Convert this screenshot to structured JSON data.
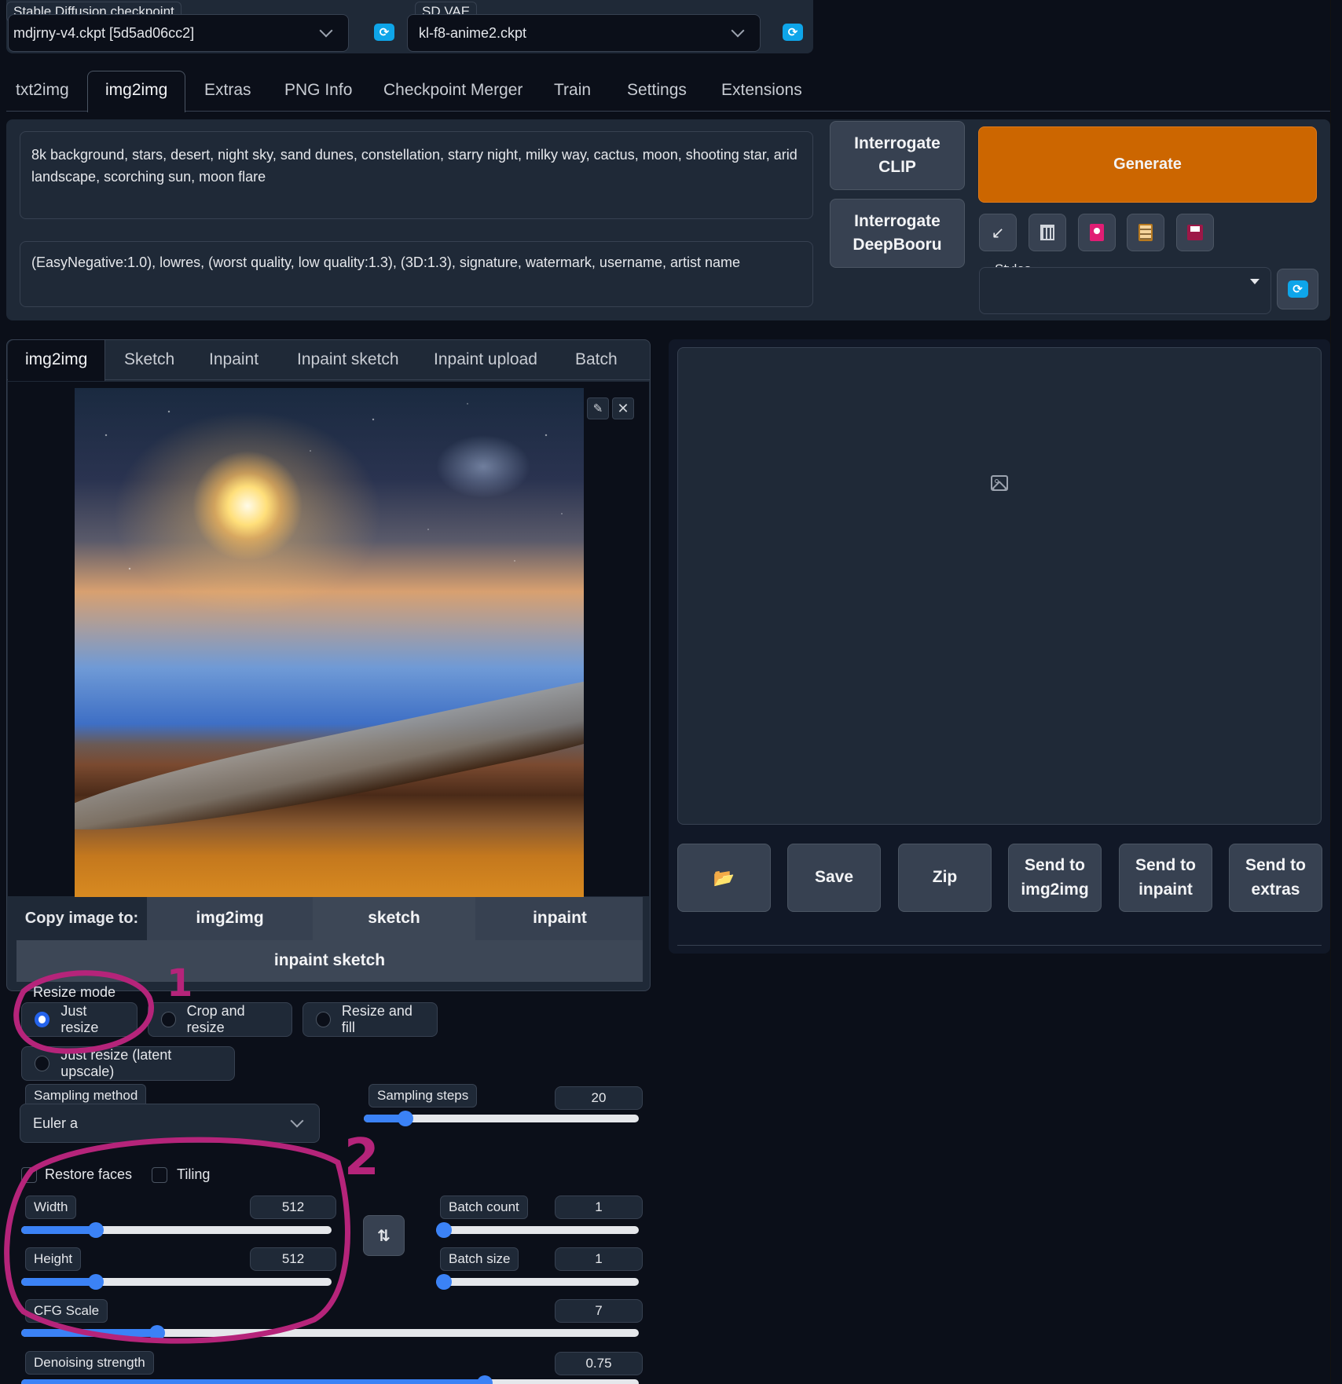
{
  "checkpoint": {
    "label": "Stable Diffusion checkpoint",
    "value": "mdjrny-v4.ckpt [5d5ad06cc2]"
  },
  "vae": {
    "label": "SD VAE",
    "value": "kl-f8-anime2.ckpt"
  },
  "main_tabs": [
    "txt2img",
    "img2img",
    "Extras",
    "PNG Info",
    "Checkpoint Merger",
    "Train",
    "Settings",
    "Extensions"
  ],
  "prompt": "8k background, stars, desert, night sky, sand dunes, constellation, starry night, milky way, cactus, moon, shooting star, arid landscape, scorching sun, moon flare",
  "negative_prompt": "(EasyNegative:1.0), lowres, (worst quality, low quality:1.3), (3D:1.3), signature, watermark, username, artist name",
  "buttons": {
    "interrogate_clip": "Interrogate CLIP",
    "interrogate_deepbooru": "Interrogate DeepBooru",
    "generate": "Generate",
    "tool_icons": [
      "↙",
      "🗑",
      "◼",
      "📋",
      "💾"
    ]
  },
  "styles_label": "Styles",
  "sub_tabs": [
    "img2img",
    "Sketch",
    "Inpaint",
    "Inpaint sketch",
    "Inpaint upload",
    "Batch"
  ],
  "copy_image": {
    "label": "Copy image to:",
    "targets": [
      "img2img",
      "sketch",
      "inpaint",
      "inpaint sketch"
    ]
  },
  "resize_mode": {
    "label": "Resize mode",
    "options": [
      "Just resize",
      "Crop and resize",
      "Resize and fill",
      "Just resize (latent upscale)"
    ],
    "selected": "Just resize"
  },
  "sampling_method": {
    "label": "Sampling method",
    "value": "Euler a"
  },
  "sampling_steps": {
    "label": "Sampling steps",
    "value": "20",
    "fraction": 0.15
  },
  "checkboxes": {
    "restore_faces": "Restore faces",
    "tiling": "Tiling"
  },
  "width": {
    "label": "Width",
    "value": "512",
    "fraction": 0.24
  },
  "height": {
    "label": "Height",
    "value": "512",
    "fraction": 0.24
  },
  "batch_count": {
    "label": "Batch count",
    "value": "1",
    "fraction": 0.0
  },
  "batch_size": {
    "label": "Batch size",
    "value": "1",
    "fraction": 0.0
  },
  "cfg_scale": {
    "label": "CFG Scale",
    "value": "7",
    "fraction": 0.22
  },
  "denoising": {
    "label": "Denoising strength",
    "value": "0.75",
    "fraction": 0.75
  },
  "output_buttons": {
    "folder_icon": "📂",
    "save": "Save",
    "zip": "Zip",
    "send_img2img": "Send to img2img",
    "send_inpaint": "Send to inpaint",
    "send_extras": "Send to extras"
  },
  "annotations": [
    "1",
    "2"
  ],
  "colors": {
    "accent": "#cc6600",
    "bg": "#0b0f19",
    "panel": "#1f2937",
    "slider": "#3b82f6",
    "annotation": "#b5247a"
  }
}
